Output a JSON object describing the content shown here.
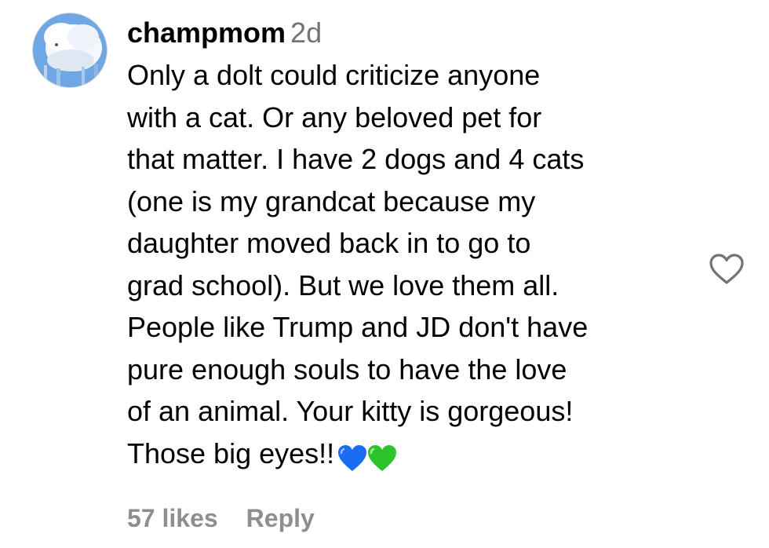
{
  "comment": {
    "username": "champmom",
    "timestamp": "2d",
    "avatar_icon": "cloud-sky-avatar",
    "lines": [
      "Only a dolt could criticize anyone",
      "with a cat. Or any beloved pet for",
      "that matter. I have 2 dogs and 4 cats",
      "(one is my grandcat because my",
      "daughter moved back in to go to",
      "grad school). But we love them all.",
      "People like Trump and JD don't have",
      "pure enough souls to have the love",
      "of an animal. Your kitty is gorgeous!",
      "Those big eyes!!"
    ],
    "emojis": [
      "blue-heart-emoji",
      "green-heart-emoji"
    ],
    "likes": "57 likes",
    "reply_label": "Reply",
    "like_icon": "heart-outline-icon"
  },
  "colors": {
    "meta_gray": "#737373",
    "footer_gray": "#8e8e8e",
    "blue_heart": "#1a6cf0",
    "green_heart": "#2bc52b"
  }
}
